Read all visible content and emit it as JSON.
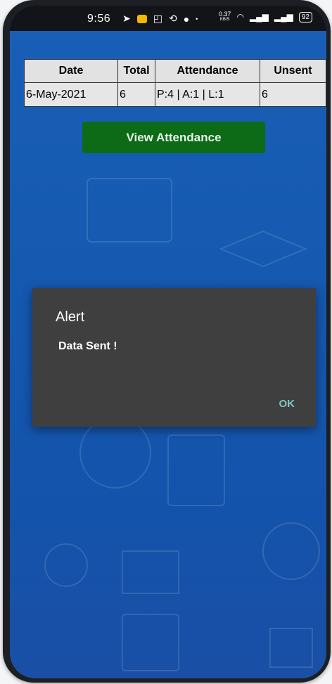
{
  "status_bar": {
    "time": "9:56",
    "icons": [
      "telegram-icon",
      "app-icon",
      "gallery-icon",
      "sync-icon",
      "record-icon",
      "dot-icon"
    ],
    "net_speed_value": "0.37",
    "net_speed_unit": "KB/S",
    "battery": "92"
  },
  "table": {
    "headers": [
      "Date",
      "Total",
      "Attendance",
      "Unsent"
    ],
    "row": [
      "6-May-2021",
      "6",
      "P:4 | A:1 | L:1",
      "6"
    ]
  },
  "view_button": {
    "label": "View Attendance"
  },
  "dialog": {
    "title": "Alert",
    "message": "Data Sent !",
    "ok_label": "OK"
  },
  "colors": {
    "screen_bg": "#1559b0",
    "button_bg": "#0d6b17",
    "dialog_bg": "#3f3f3f",
    "ok_text": "#7fcac0"
  }
}
